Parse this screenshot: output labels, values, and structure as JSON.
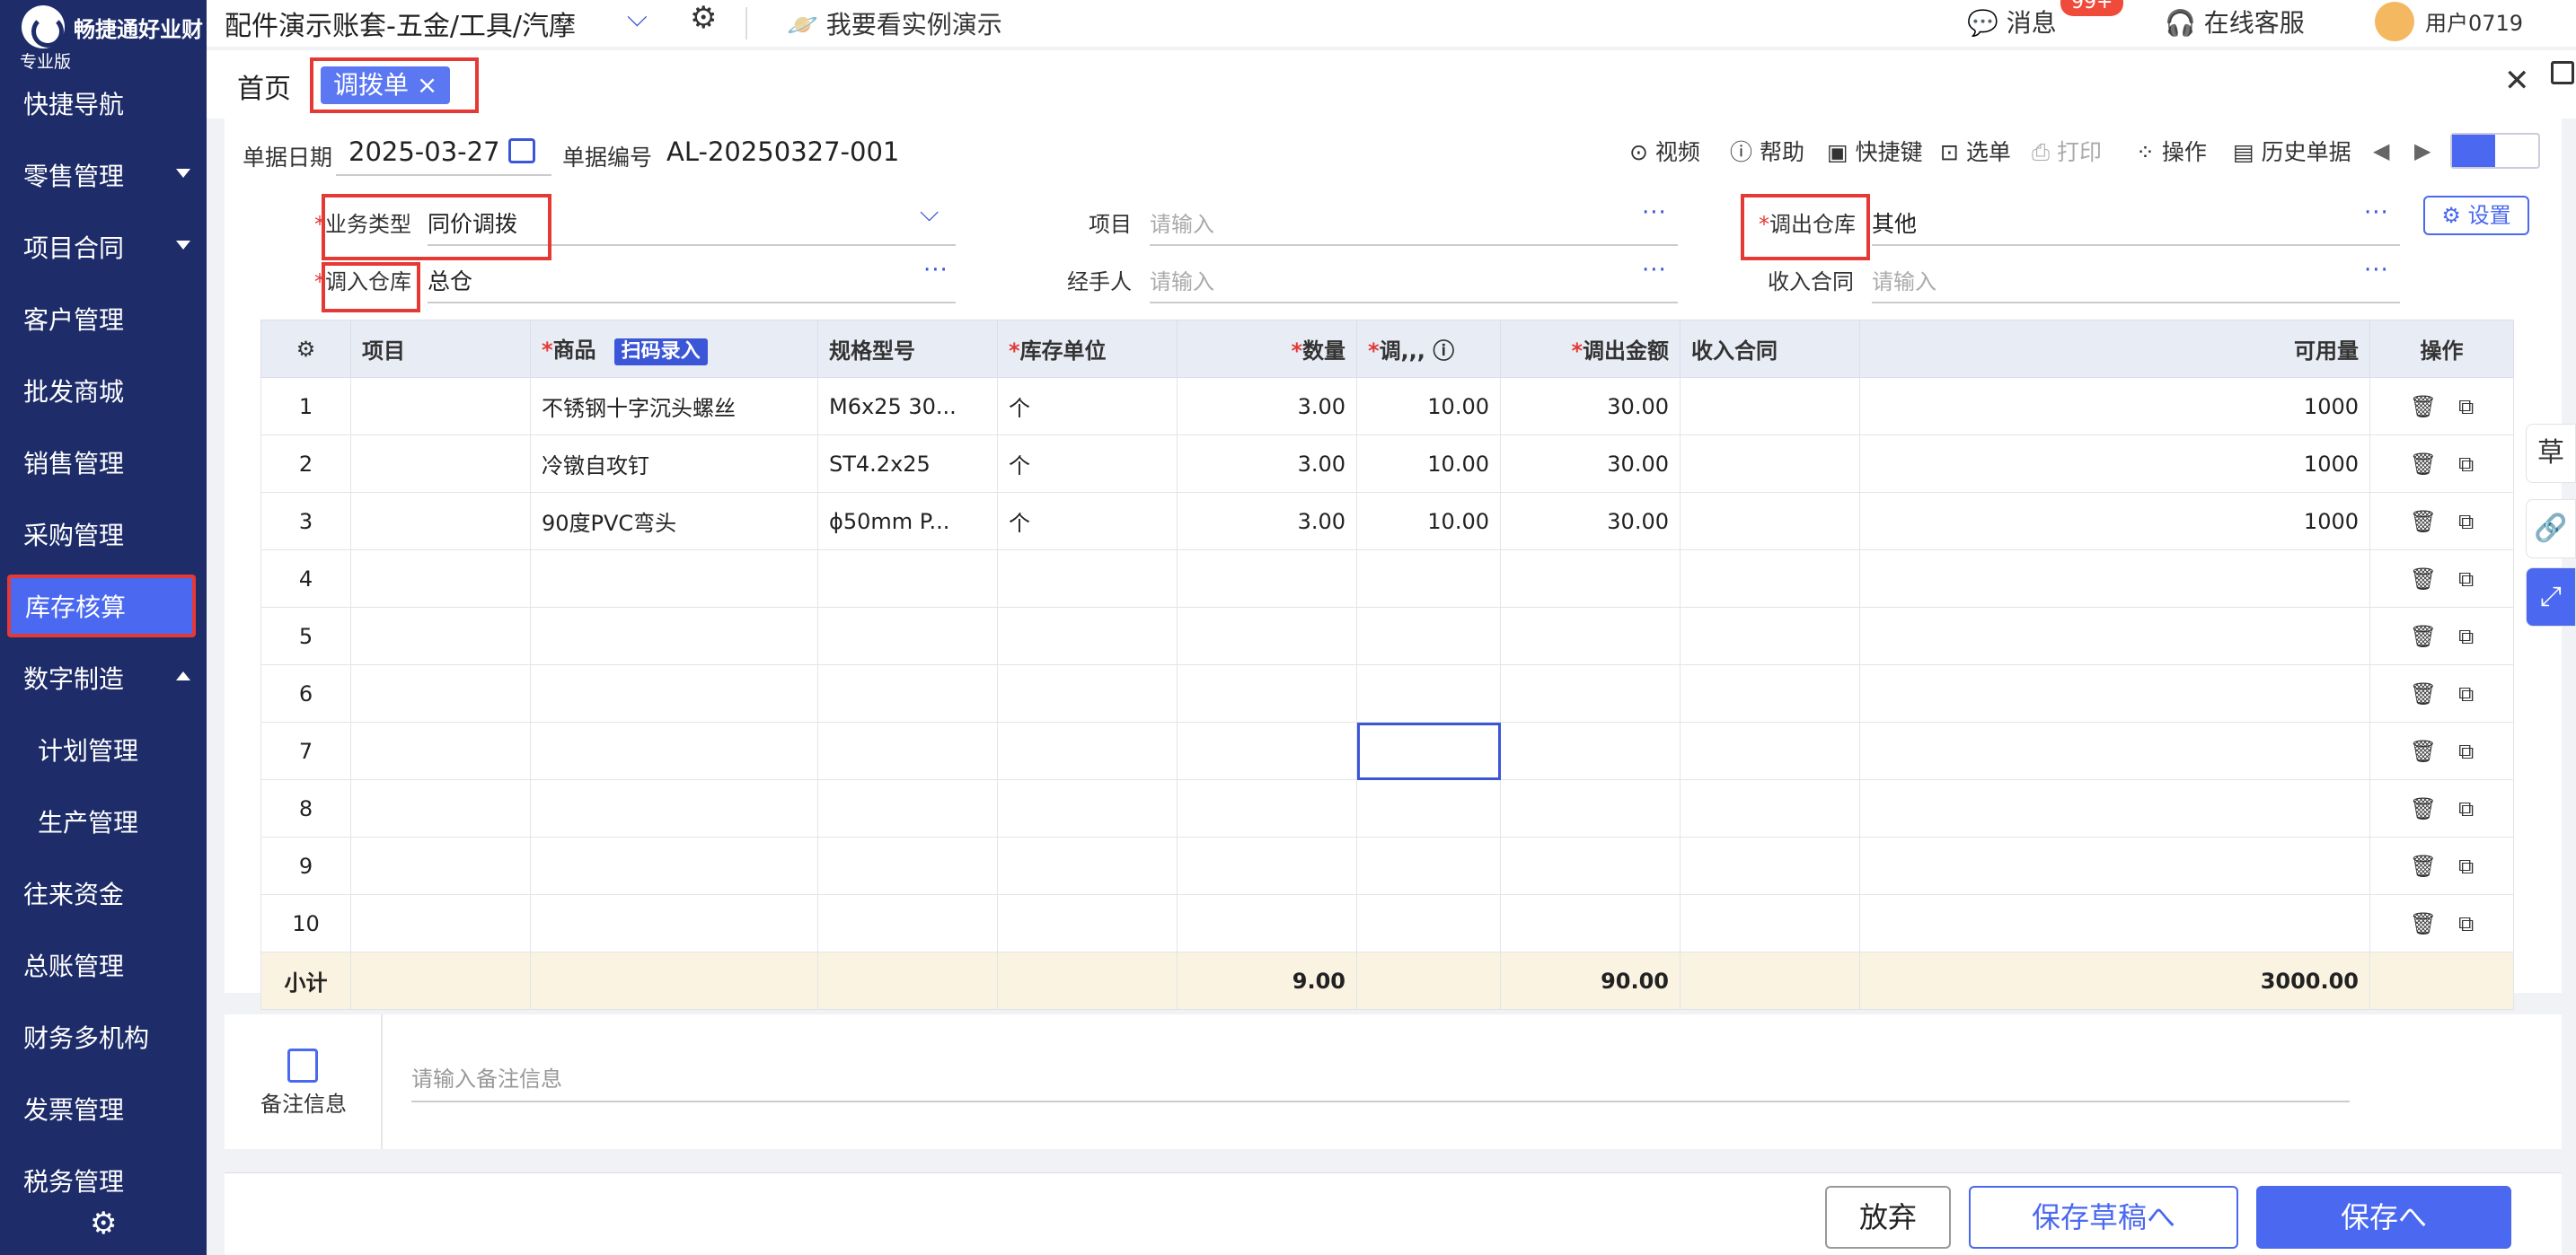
{
  "sidebar": {
    "logo_name": "畅捷通好业财",
    "logo_sub": "专业版",
    "items": [
      {
        "label": "快捷导航"
      },
      {
        "label": "零售管理"
      },
      {
        "label": "项目合同"
      },
      {
        "label": "客户管理"
      },
      {
        "label": "批发商城"
      },
      {
        "label": "销售管理"
      },
      {
        "label": "采购管理"
      },
      {
        "label": "库存核算"
      },
      {
        "label": "数字制造"
      },
      {
        "label": "计划管理"
      },
      {
        "label": "生产管理"
      },
      {
        "label": "往来资金"
      },
      {
        "label": "总账管理"
      },
      {
        "label": "财务多机构"
      },
      {
        "label": "发票管理"
      },
      {
        "label": "税务管理"
      }
    ],
    "gear_icon": "⚙"
  },
  "topbar": {
    "account": "配件演示账套-五金/工具/汽摩",
    "demo": "我要看实例演示",
    "messages": "消息",
    "badge": "99+",
    "service": "在线客服",
    "user": "用户0719"
  },
  "tabs": {
    "home": "首页",
    "active": "调拨单 ×"
  },
  "header": {
    "date_label": "单据日期",
    "date_value": "2025-03-27",
    "no_label": "单据编号",
    "no_value": "AL-20250327-001",
    "tools": [
      "视频",
      "帮助",
      "快捷键",
      "选单",
      "打印",
      "操作",
      "历史单据"
    ]
  },
  "form": {
    "biz_type_label": "业务类型",
    "biz_type_value": "同价调拨",
    "project_label": "项目",
    "project_placeholder": "请输入",
    "out_wh_label": "调出仓库",
    "out_wh_value": "其他",
    "in_wh_label": "调入仓库",
    "in_wh_value": "总仓",
    "handler_label": "经手人",
    "handler_placeholder": "请输入",
    "contract_label": "收入合同",
    "contract_placeholder": "请输入",
    "settings": "设置",
    "dots": "···"
  },
  "table": {
    "headers": {
      "project": "项目",
      "product": "商品",
      "scan": "扫码录入",
      "spec": "规格型号",
      "unit": "库存单位",
      "qty": "数量",
      "price": "调,,,",
      "amount": "调出金额",
      "contract": "收入合同",
      "avail": "可用量",
      "ops": "操作"
    },
    "rows": [
      {
        "no": "1",
        "product": "不锈钢十字沉头螺丝",
        "spec": "M6x25 30...",
        "unit": "个",
        "qty": "3.00",
        "price": "10.00",
        "amount": "30.00",
        "avail": "1000"
      },
      {
        "no": "2",
        "product": "冷镦自攻钉",
        "spec": "ST4.2x25",
        "unit": "个",
        "qty": "3.00",
        "price": "10.00",
        "amount": "30.00",
        "avail": "1000"
      },
      {
        "no": "3",
        "product": "90度PVC弯头",
        "spec": "ϕ50mm P...",
        "unit": "个",
        "qty": "3.00",
        "price": "10.00",
        "amount": "30.00",
        "avail": "1000"
      },
      {
        "no": "4"
      },
      {
        "no": "5"
      },
      {
        "no": "6"
      },
      {
        "no": "7"
      },
      {
        "no": "8"
      },
      {
        "no": "9"
      },
      {
        "no": "10"
      }
    ],
    "subtotal": {
      "label": "小计",
      "qty": "9.00",
      "amount": "90.00",
      "avail": "3000.00"
    }
  },
  "remark": {
    "label": "备注信息",
    "placeholder": "请输入备注信息"
  },
  "footer": {
    "discard": "放弃",
    "draft": "保存草稿へ",
    "save": "保存へ"
  },
  "right_rail": {
    "draft_icon": "草"
  },
  "colors": {
    "sidebar": "#1e2d69",
    "accent": "#4a68f0",
    "highlight": "#e53935",
    "subtotal": "#fbf3e2"
  }
}
